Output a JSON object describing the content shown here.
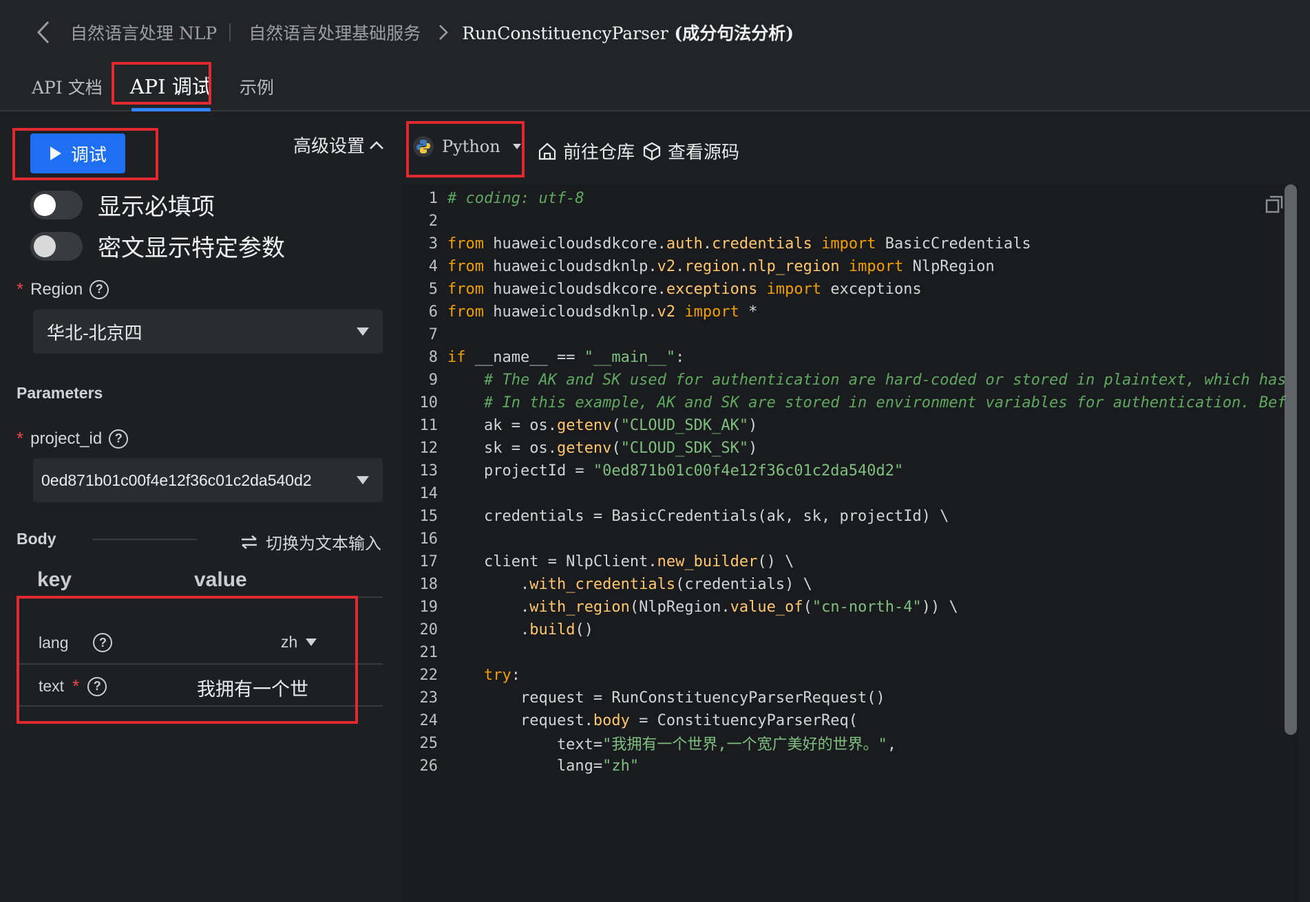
{
  "breadcrumb": {
    "items": [
      "自然语言处理 NLP",
      "自然语言处理基础服务"
    ],
    "current_en": "RunConstituencyParser",
    "current_cn": " (成分句法分析)"
  },
  "tabs": [
    {
      "label": "API 文档"
    },
    {
      "label": "API 调试"
    },
    {
      "label": "示例"
    }
  ],
  "left": {
    "debug_button": "调试",
    "advanced": "高级设置",
    "toggle_required": "显示必填项",
    "toggle_cipher": "密文显示特定参数",
    "region_label": "Region",
    "region_value": "华北-北京四",
    "parameters_title": "Parameters",
    "project_label": "project_id",
    "project_value": "0ed871b01c00f4e12f36c01c2da540d2",
    "body_title": "Body",
    "switch_text": "切换为文本输入",
    "kv_key": "key",
    "kv_value": "value",
    "rows": [
      {
        "key": "lang",
        "value": "zh"
      },
      {
        "key": "text",
        "value": "我拥有一个世"
      }
    ]
  },
  "toolbar": {
    "language": "Python",
    "repo": "前往仓库",
    "source": "查看源码"
  },
  "code_lines": [
    "# coding: utf-8",
    "",
    "from huaweicloudsdkcore.auth.credentials import BasicCredentials",
    "from huaweicloudsdknlp.v2.region.nlp_region import NlpRegion",
    "from huaweicloudsdkcore.exceptions import exceptions",
    "from huaweicloudsdknlp.v2 import *",
    "",
    "if __name__ == \"__main__\":",
    "    # The AK and SK used for authentication are hard-coded or stored in plaintext, which has",
    "    # In this example, AK and SK are stored in environment variables for authentication. Bef",
    "    ak = os.getenv(\"CLOUD_SDK_AK\")",
    "    sk = os.getenv(\"CLOUD_SDK_SK\")",
    "    projectId = \"0ed871b01c00f4e12f36c01c2da540d2\"",
    "",
    "    credentials = BasicCredentials(ak, sk, projectId) \\",
    "",
    "    client = NlpClient.new_builder() \\",
    "        .with_credentials(credentials) \\",
    "        .with_region(NlpRegion.value_of(\"cn-north-4\")) \\",
    "        .build()",
    "",
    "    try:",
    "        request = RunConstituencyParserRequest()",
    "        request.body = ConstituencyParserReq(",
    "            text=\"我拥有一个世界,一个宽广美好的世界。\",",
    "            lang=\"zh\""
  ]
}
